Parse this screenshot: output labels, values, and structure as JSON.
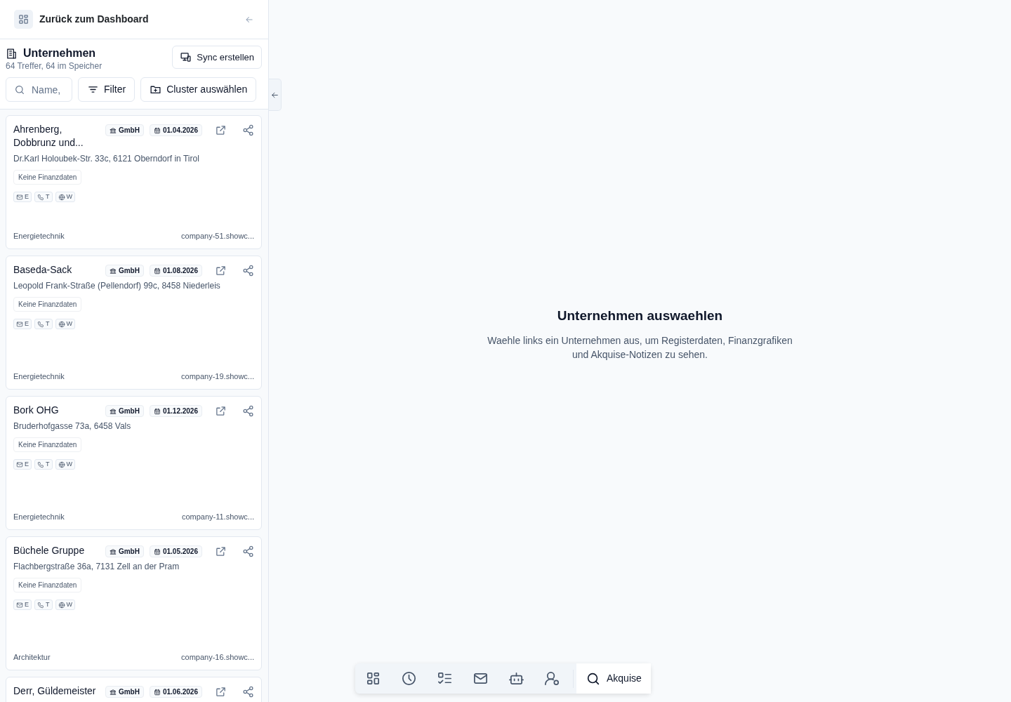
{
  "sidebar": {
    "back_link": "Zurück zum Dashboard",
    "title": "Unternehmen",
    "subtitle": "64 Treffer, 64 im Speicher",
    "sync_button": "Sync erstellen",
    "search": {
      "placeholder": "Name,"
    },
    "filter_button": "Filter",
    "cluster_button": "Cluster auswählen"
  },
  "companies": [
    {
      "name": "Ahrenberg, Dobbrunz und...",
      "legal_form": "GmbH",
      "date": "01.04.2026",
      "address": "Dr.Karl Holoubek-Str. 33c, 6121 Oberndorf in Tirol",
      "finance_tag": "Keine Finanzdaten",
      "contacts": [
        {
          "kind": "email",
          "label": "E"
        },
        {
          "kind": "phone",
          "label": "T"
        },
        {
          "kind": "web",
          "label": "W"
        }
      ],
      "industry": "Energietechnik",
      "website": "company-51.showc..."
    },
    {
      "name": "Baseda-Sack",
      "legal_form": "GmbH",
      "date": "01.08.2026",
      "address": "Leopold Frank-Straße (Pellendorf) 99c, 8458 Niederleis",
      "finance_tag": "Keine Finanzdaten",
      "contacts": [
        {
          "kind": "email",
          "label": "E"
        },
        {
          "kind": "phone",
          "label": "T"
        },
        {
          "kind": "web",
          "label": "W"
        }
      ],
      "industry": "Energietechnik",
      "website": "company-19.showc..."
    },
    {
      "name": "Bork OHG",
      "legal_form": "GmbH",
      "date": "01.12.2026",
      "address": "Bruderhofgasse 73a, 6458 Vals",
      "finance_tag": "Keine Finanzdaten",
      "contacts": [
        {
          "kind": "email",
          "label": "E"
        },
        {
          "kind": "phone",
          "label": "T"
        },
        {
          "kind": "web",
          "label": "W"
        }
      ],
      "industry": "Energietechnik",
      "website": "company-11.showc..."
    },
    {
      "name": "Büchele Gruppe",
      "legal_form": "GmbH",
      "date": "01.05.2026",
      "address": "Flachbergstraße 36a, 7131 Zell an der Pram",
      "finance_tag": "Keine Finanzdaten",
      "contacts": [
        {
          "kind": "email",
          "label": "E"
        },
        {
          "kind": "phone",
          "label": "T"
        },
        {
          "kind": "web",
          "label": "W"
        }
      ],
      "industry": "Architektur",
      "website": "company-16.showc..."
    },
    {
      "name": "Derr, Güldemeister",
      "legal_form": "GmbH",
      "date": "01.06.2026"
    }
  ],
  "empty_state": {
    "title": "Unternehmen auswaehlen",
    "text": "Waehle links ein Unternehmen aus, um Registerdaten, Finanzgrafiken und Akquise-Notizen zu sehen."
  },
  "dock": [
    {
      "kind": "dashboard",
      "selected": false
    },
    {
      "kind": "clock",
      "selected": false
    },
    {
      "kind": "tasks",
      "selected": false
    },
    {
      "kind": "mail",
      "selected": false
    },
    {
      "kind": "bot",
      "selected": false
    },
    {
      "kind": "user-settings",
      "selected": false
    },
    {
      "kind": "search",
      "label": "Akquise",
      "selected": true
    }
  ]
}
